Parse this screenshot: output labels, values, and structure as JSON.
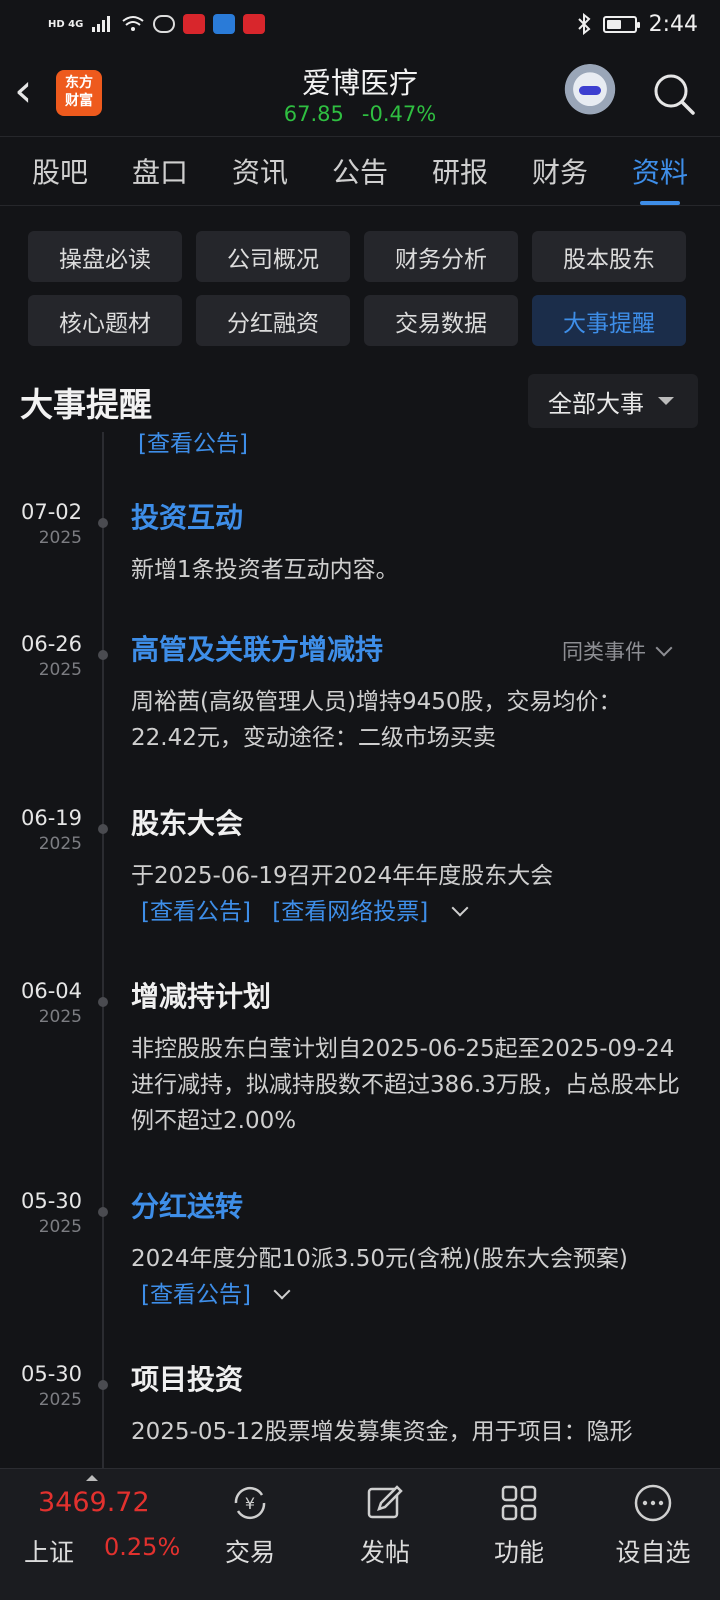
{
  "status_bar": {
    "network": "HD 4G",
    "time": "2:44"
  },
  "header": {
    "back_label": "‹",
    "logo_text_line1": "东方",
    "logo_text_line2": "财富",
    "stock_name": "爱博医疗",
    "price": "67.85",
    "change": "-0.47%",
    "quote_color": "#2fbf41"
  },
  "tabs": [
    {
      "label": "股吧"
    },
    {
      "label": "盘口"
    },
    {
      "label": "资讯"
    },
    {
      "label": "公告"
    },
    {
      "label": "研报"
    },
    {
      "label": "财务"
    },
    {
      "label": "资料",
      "active": true
    }
  ],
  "sub_buttons": [
    {
      "label": "操盘必读"
    },
    {
      "label": "公司概况"
    },
    {
      "label": "财务分析"
    },
    {
      "label": "股本股东"
    },
    {
      "label": "核心题材"
    },
    {
      "label": "分红融资"
    },
    {
      "label": "交易数据"
    },
    {
      "label": "大事提醒",
      "active": true
    }
  ],
  "section": {
    "title": "大事提醒",
    "filter_label": "全部大事"
  },
  "timeline": {
    "top_link": "[查看公告]",
    "events": [
      {
        "date": "07-02",
        "year": "2025",
        "title": "投资互动",
        "desc": "新增1条投资者互动内容。"
      },
      {
        "date": "06-26",
        "year": "2025",
        "title": "高管及关联方增减持",
        "similar": "同类事件",
        "desc": "周裕茜(高级管理人员)增持9450股，交易均价：22.42元，变动途径：二级市场买卖"
      },
      {
        "date": "06-19",
        "year": "2025",
        "title": "股东大会",
        "desc": "于2025-06-19召开2024年年度股东大会",
        "link1": "[查看公告]",
        "link2": "[查看网络投票]"
      },
      {
        "date": "06-04",
        "year": "2025",
        "title": "增减持计划",
        "desc": "非控股股东白莹计划自2025-06-25起至2025-09-24进行减持，拟减持股数不超过386.3万股，占总股本比例不超过2.00%"
      },
      {
        "date": "05-30",
        "year": "2025",
        "title": "分红送转",
        "desc": "2024年度分配10派3.50元(含税)(股东大会预案)",
        "link1": "[查看公告]"
      },
      {
        "date": "05-30",
        "year": "2025",
        "title": "项目投资",
        "desc": "2025-05-12股票增发募集资金，用于项目：隐形"
      }
    ]
  },
  "bottom_bar": {
    "index_value": "3469.72",
    "index_name": "上证",
    "index_change": "0.25%",
    "items": [
      {
        "label": "交易",
        "icon": "yuan-cycle-icon"
      },
      {
        "label": "发帖",
        "icon": "edit-icon"
      },
      {
        "label": "功能",
        "icon": "grid-icon"
      },
      {
        "label": "设自选",
        "icon": "more-icon"
      }
    ]
  }
}
